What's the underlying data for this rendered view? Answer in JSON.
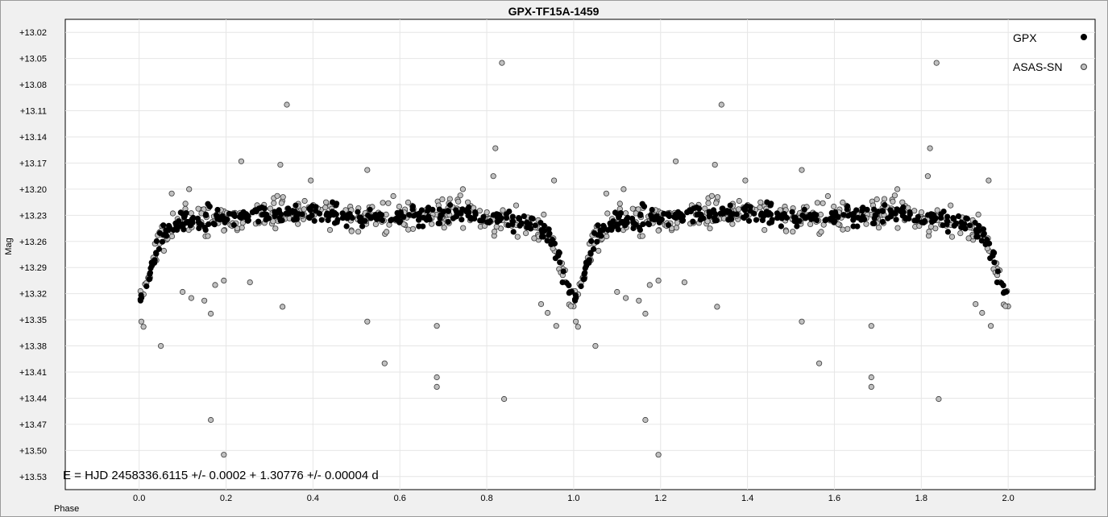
{
  "chart_data": {
    "type": "scatter",
    "title": "GPX-TF15A-1459",
    "xlabel": "Phase",
    "ylabel": "Mag",
    "xlim": [
      -0.17,
      2.2
    ],
    "ylim": [
      13.545,
      13.005
    ],
    "y_inverted": true,
    "xticks": [
      0.0,
      0.2,
      0.4,
      0.6,
      0.8,
      1.0,
      1.2,
      1.4,
      1.6,
      1.8,
      2.0
    ],
    "xtick_labels": [
      "0.0",
      "0.2",
      "0.4",
      "0.6",
      "0.8",
      "1.0",
      "1.2",
      "1.4",
      "1.6",
      "1.8",
      "2.0"
    ],
    "yticks": [
      13.02,
      13.05,
      13.08,
      13.11,
      13.14,
      13.17,
      13.2,
      13.23,
      13.26,
      13.29,
      13.32,
      13.35,
      13.38,
      13.41,
      13.44,
      13.47,
      13.5,
      13.53
    ],
    "ytick_labels": [
      "+13.02",
      "+13.05",
      "+13.08",
      "+13.11",
      "+13.14",
      "+13.17",
      "+13.20",
      "+13.23",
      "+13.26",
      "+13.29",
      "+13.32",
      "+13.35",
      "+13.38",
      "+13.41",
      "+13.44",
      "+13.47",
      "+13.50",
      "+13.53"
    ],
    "grid": true,
    "legend_position": "top-right",
    "period_days": 1.30776,
    "annotation": "E = HJD 2458336.6115 +/- 0.0002 + 1.30776 +/- 0.00004 d",
    "series": [
      {
        "name": "GPX",
        "color": "#000000",
        "stroke": "#000000",
        "light_curve": {
          "phase": [
            0.0,
            0.01,
            0.02,
            0.03,
            0.04,
            0.05,
            0.06,
            0.08,
            0.1,
            0.15,
            0.2,
            0.3,
            0.4,
            0.5,
            0.6,
            0.7,
            0.8,
            0.85,
            0.9,
            0.93,
            0.95,
            0.96,
            0.97,
            0.98,
            0.99,
            1.0
          ],
          "mag": [
            13.325,
            13.318,
            13.305,
            13.288,
            13.268,
            13.255,
            13.248,
            13.242,
            13.238,
            13.235,
            13.232,
            13.228,
            13.228,
            13.232,
            13.232,
            13.228,
            13.232,
            13.238,
            13.242,
            13.246,
            13.258,
            13.27,
            13.285,
            13.302,
            13.318,
            13.325
          ],
          "scatter_mag": 0.011,
          "n_points": 320
        }
      },
      {
        "name": "ASAS-SN",
        "color": "#c0c0c0",
        "stroke": "#3a3a3a",
        "light_curve": {
          "phase": [
            0.0,
            0.01,
            0.02,
            0.03,
            0.04,
            0.05,
            0.06,
            0.08,
            0.1,
            0.15,
            0.2,
            0.3,
            0.4,
            0.5,
            0.6,
            0.7,
            0.8,
            0.85,
            0.9,
            0.93,
            0.95,
            0.96,
            0.97,
            0.98,
            0.99,
            1.0
          ],
          "mag": [
            13.325,
            13.318,
            13.305,
            13.288,
            13.268,
            13.255,
            13.248,
            13.242,
            13.238,
            13.235,
            13.232,
            13.228,
            13.228,
            13.232,
            13.232,
            13.228,
            13.232,
            13.238,
            13.242,
            13.246,
            13.258,
            13.27,
            13.285,
            13.302,
            13.318,
            13.325
          ],
          "scatter_mag": 0.017,
          "n_points": 300
        },
        "outliers": [
          {
            "phase": 0.835,
            "mag": 13.055
          },
          {
            "phase": 0.34,
            "mag": 13.103
          },
          {
            "phase": 0.82,
            "mag": 13.153
          },
          {
            "phase": 0.235,
            "mag": 13.168
          },
          {
            "phase": 0.325,
            "mag": 13.172
          },
          {
            "phase": 0.525,
            "mag": 13.178
          },
          {
            "phase": 0.815,
            "mag": 13.185
          },
          {
            "phase": 0.955,
            "mag": 13.19
          },
          {
            "phase": 0.33,
            "mag": 13.335
          },
          {
            "phase": 0.525,
            "mag": 13.352
          },
          {
            "phase": 0.005,
            "mag": 13.352
          },
          {
            "phase": 0.01,
            "mag": 13.358
          },
          {
            "phase": 0.685,
            "mag": 13.357
          },
          {
            "phase": 0.05,
            "mag": 13.38
          },
          {
            "phase": 0.565,
            "mag": 13.4
          },
          {
            "phase": 0.685,
            "mag": 13.416
          },
          {
            "phase": 0.685,
            "mag": 13.427
          },
          {
            "phase": 0.84,
            "mag": 13.441
          },
          {
            "phase": 0.165,
            "mag": 13.465
          },
          {
            "phase": 0.195,
            "mag": 13.505
          },
          {
            "phase": 0.165,
            "mag": 13.343
          },
          {
            "phase": 0.15,
            "mag": 13.328
          },
          {
            "phase": 0.12,
            "mag": 13.325
          },
          {
            "phase": 0.1,
            "mag": 13.318
          },
          {
            "phase": 0.195,
            "mag": 13.305
          },
          {
            "phase": 0.255,
            "mag": 13.307
          },
          {
            "phase": 0.175,
            "mag": 13.31
          },
          {
            "phase": 0.925,
            "mag": 13.332
          },
          {
            "phase": 0.94,
            "mag": 13.342
          },
          {
            "phase": 0.96,
            "mag": 13.357
          },
          {
            "phase": 0.075,
            "mag": 13.205
          },
          {
            "phase": 0.115,
            "mag": 13.2
          },
          {
            "phase": 0.395,
            "mag": 13.19
          },
          {
            "phase": 0.585,
            "mag": 13.208
          },
          {
            "phase": 0.745,
            "mag": 13.2
          }
        ]
      }
    ]
  }
}
